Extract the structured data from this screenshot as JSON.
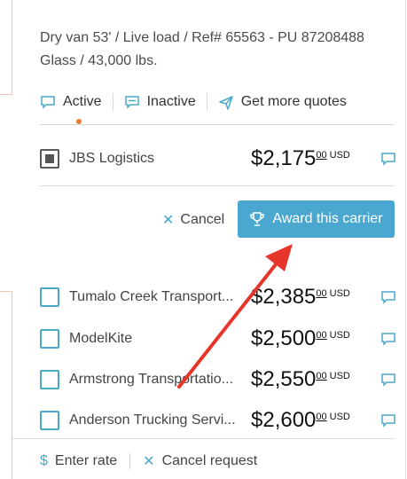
{
  "load": {
    "description": "Dry van 53' / Live load / Ref# 65563 - PU 87208488 Glass / 43,000 lbs."
  },
  "tabs": [
    {
      "label": "Active",
      "icon": "chat-icon"
    },
    {
      "label": "Inactive",
      "icon": "chat-icon"
    },
    {
      "label": "Get more quotes",
      "icon": "send-icon"
    }
  ],
  "selected_carrier": {
    "name": "JBS Logistics",
    "price": "$2,175",
    "cents": "00",
    "currency": "USD"
  },
  "actions": {
    "cancel_label": "Cancel",
    "award_label": "Award this carrier"
  },
  "carriers": [
    {
      "name": "Tumalo Creek Transport...",
      "price": "$2,385",
      "cents": "00",
      "currency": "USD"
    },
    {
      "name": "ModelKite",
      "price": "$2,500",
      "cents": "00",
      "currency": "USD"
    },
    {
      "name": "Armstrong Transportatio...",
      "price": "$2,550",
      "cents": "00",
      "currency": "USD"
    },
    {
      "name": "Anderson Trucking Servi...",
      "price": "$2,600",
      "cents": "00",
      "currency": "USD"
    }
  ],
  "footer": {
    "enter_rate": "Enter rate",
    "cancel_request": "Cancel request"
  },
  "colors": {
    "accent": "#4aa8d0",
    "active_dot": "#f07a2a",
    "annotation_arrow": "#e8352b"
  }
}
